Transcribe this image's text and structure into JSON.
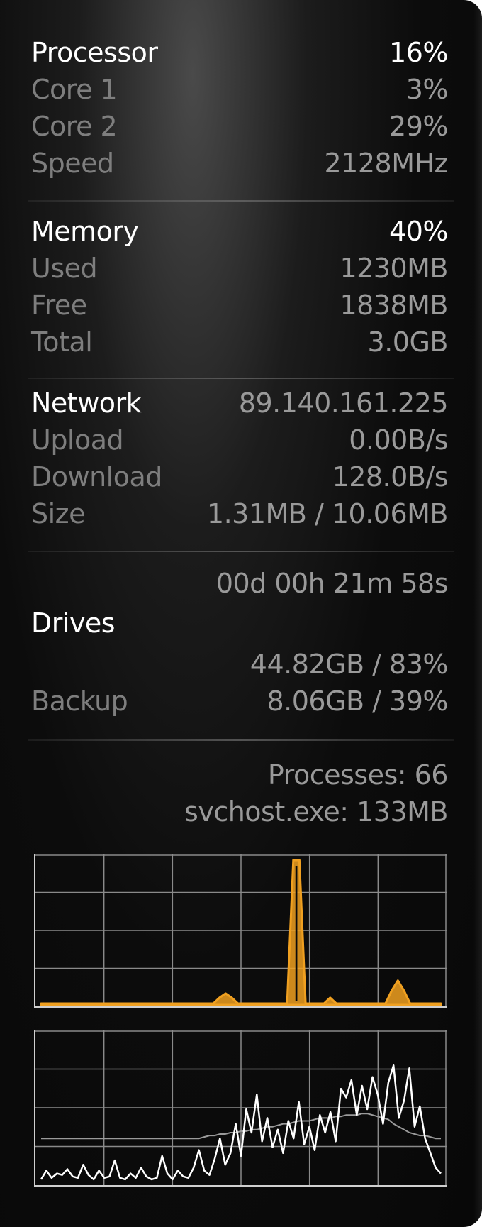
{
  "processor": {
    "title": "Processor",
    "total": "16%",
    "rows": [
      {
        "label": "Core 1",
        "value": "3%"
      },
      {
        "label": "Core 2",
        "value": "29%"
      },
      {
        "label": "Speed",
        "value": "2128MHz"
      }
    ]
  },
  "memory": {
    "title": "Memory",
    "total": "40%",
    "rows": [
      {
        "label": "Used",
        "value": "1230MB"
      },
      {
        "label": "Free",
        "value": "1838MB"
      },
      {
        "label": "Total",
        "value": "3.0GB"
      }
    ]
  },
  "network": {
    "title": "Network",
    "ip": "89.140.161.225",
    "rows": [
      {
        "label": "Upload",
        "value": "0.00B/s"
      },
      {
        "label": "Download",
        "value": "128.0B/s"
      },
      {
        "label": "Size",
        "value": "1.31MB / 10.06MB"
      }
    ]
  },
  "uptime": "00d 00h 21m 58s",
  "drives": {
    "title": "Drives",
    "items": [
      {
        "label": "",
        "value": "44.82GB / 83%"
      },
      {
        "label": "Backup",
        "value": "8.06GB / 39%"
      }
    ]
  },
  "processes": {
    "count_text": "Processes: 66",
    "top_text": "svchost.exe: 133MB"
  },
  "colors": {
    "accent": "#f0a020",
    "graph_line": "#ffffff",
    "grid": "#8a8a8a",
    "header_text": "#ffffff",
    "label_text": "#7e7e7e"
  },
  "chart_data": [
    {
      "type": "area",
      "series": [
        {
          "values": [
            0,
            0,
            0,
            0,
            0,
            0,
            0,
            0,
            0,
            0,
            0,
            0,
            0,
            0,
            0,
            0,
            0,
            0,
            0,
            0,
            0,
            0,
            0,
            0,
            0,
            0,
            0,
            0,
            0,
            4,
            7,
            4,
            0,
            0,
            0,
            0,
            0,
            0,
            0,
            0,
            0,
            100,
            100,
            0,
            0,
            0,
            0,
            4,
            0,
            0,
            0,
            0,
            0,
            0,
            0,
            0,
            0,
            9,
            16,
            9,
            0,
            0,
            0,
            0,
            0,
            0
          ]
        }
      ],
      "ylim": [
        0,
        100
      ],
      "grid": true
    },
    {
      "type": "line",
      "series": [
        {
          "values": [
            2,
            8,
            3,
            6,
            5,
            9,
            4,
            3,
            12,
            5,
            2,
            8,
            3,
            4,
            15,
            3,
            2,
            6,
            3,
            10,
            4,
            2,
            3,
            18,
            6,
            2,
            8,
            4,
            3,
            10,
            22,
            8,
            5,
            16,
            30,
            12,
            20,
            40,
            18,
            50,
            34,
            60,
            28,
            44,
            24,
            36,
            20,
            42,
            30,
            55,
            26,
            38,
            22,
            46,
            34,
            48,
            28,
            64,
            58,
            70,
            46,
            66,
            50,
            72,
            60,
            40,
            68,
            80,
            44,
            56,
            78,
            38,
            52,
            30,
            20,
            10,
            6
          ]
        },
        {
          "values": [
            30,
            30,
            30,
            30,
            30,
            30,
            30,
            30,
            30,
            30,
            30,
            30,
            30,
            30,
            30,
            30,
            30,
            30,
            30,
            30,
            30,
            30,
            30,
            30,
            30,
            30,
            30,
            30,
            30,
            30,
            30,
            31,
            32,
            32,
            33,
            33,
            34,
            34,
            35,
            35,
            36,
            36,
            37,
            38,
            38,
            39,
            40,
            40,
            41,
            42,
            42,
            42,
            43,
            44,
            44,
            44,
            45,
            45,
            46,
            46,
            46,
            47,
            47,
            46,
            45,
            44,
            43,
            40,
            38,
            36,
            34,
            33,
            32,
            32,
            31,
            30,
            30
          ]
        }
      ],
      "ylim": [
        0,
        100
      ],
      "grid": true
    }
  ]
}
